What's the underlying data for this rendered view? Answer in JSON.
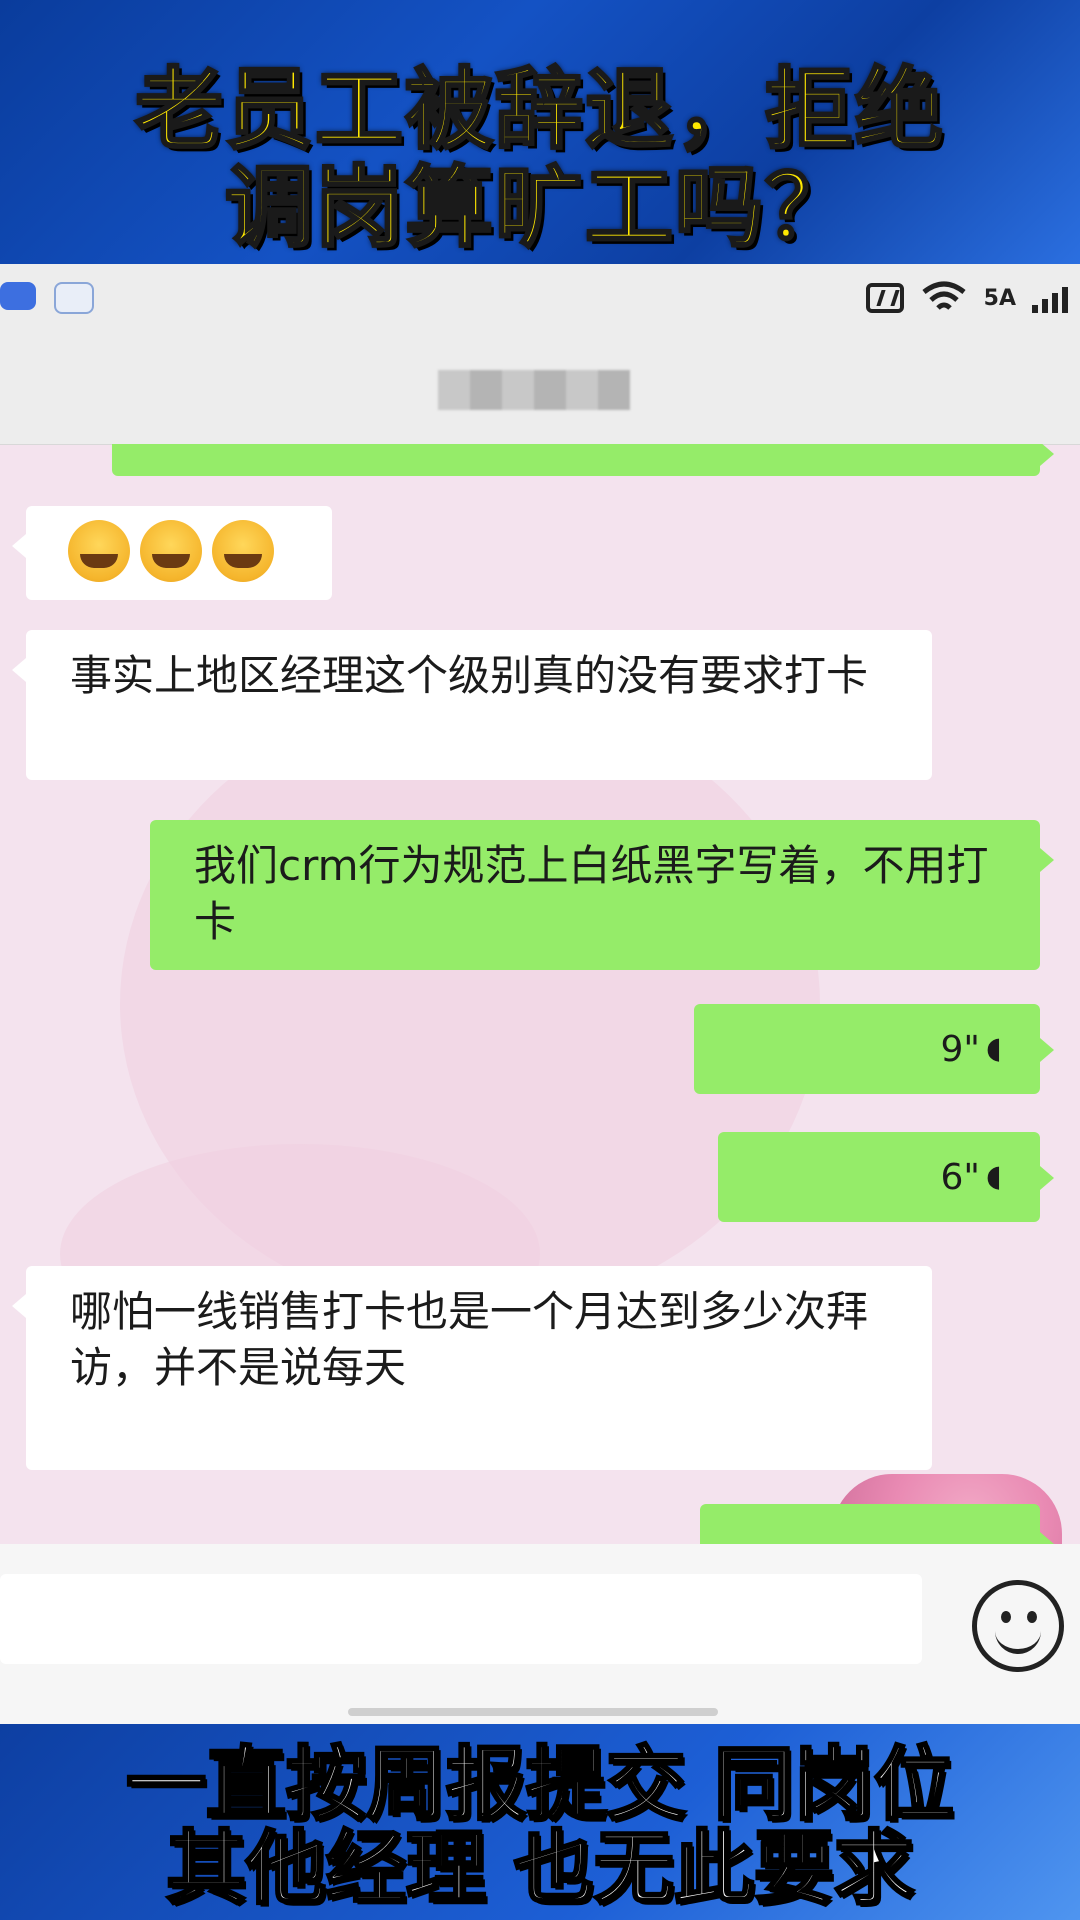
{
  "title": {
    "line1": "老员工被辞退，拒绝",
    "line2": "调岗算旷工吗？"
  },
  "status_bar": {
    "icons": [
      "app-icon",
      "app-icon",
      "nfc-icon",
      "wifi-icon",
      "signal-icon"
    ],
    "network": "5A"
  },
  "chat": {
    "contact_name": "██████",
    "messages": [
      {
        "side": "left",
        "type": "emoji",
        "icon": "facepalm-laugh-emoji",
        "count": 3
      },
      {
        "side": "left",
        "type": "text",
        "text": "事实上地区经理这个级别真的没有要求打卡"
      },
      {
        "side": "right",
        "type": "text",
        "text": "我们crm行为规范上白纸黑字写着，不用打卡"
      },
      {
        "side": "right",
        "type": "voice",
        "duration": "9\""
      },
      {
        "side": "right",
        "type": "voice",
        "duration": "6\""
      },
      {
        "side": "left",
        "type": "text",
        "text": "哪怕一线销售打卡也是一个月达到多少次拜访，并不是说每天"
      }
    ]
  },
  "input_bar": {
    "emoji_icon": "smiley-icon"
  },
  "subtitle": {
    "line1": "一直按周报提交 同岗位",
    "line2": "其他经理 也无此要求"
  },
  "colors": {
    "title_yellow": "#ffe800",
    "banner_blue": "#0b3e9a",
    "chat_green": "#95ec69",
    "chat_bg": "#f4e3ee"
  }
}
